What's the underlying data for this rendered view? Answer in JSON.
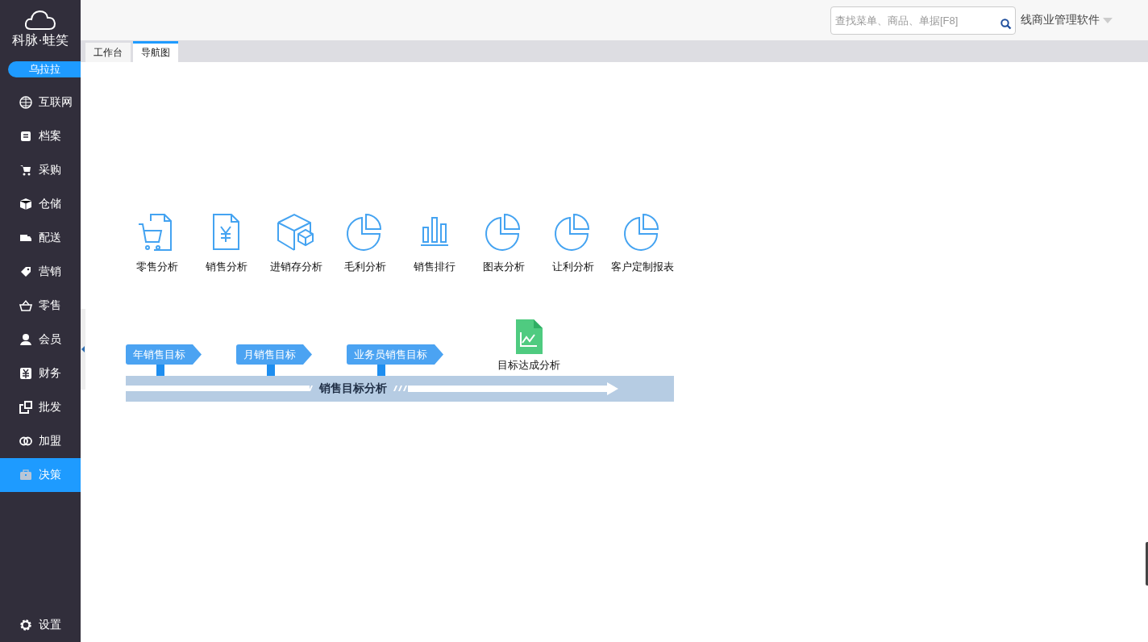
{
  "sidebar": {
    "logo_text": "科脉·蛙笑",
    "user": "乌拉拉",
    "items": [
      {
        "label": "互联网",
        "selected": false
      },
      {
        "label": "档案",
        "selected": false
      },
      {
        "label": "采购",
        "selected": false
      },
      {
        "label": "仓储",
        "selected": false
      },
      {
        "label": "配送",
        "selected": false
      },
      {
        "label": "营销",
        "selected": false
      },
      {
        "label": "零售",
        "selected": false
      },
      {
        "label": "会员",
        "selected": false
      },
      {
        "label": "财务",
        "selected": false
      },
      {
        "label": "批发",
        "selected": false
      },
      {
        "label": "加盟",
        "selected": false
      },
      {
        "label": "决策",
        "selected": true
      }
    ],
    "settings": "设置"
  },
  "header": {
    "search": {
      "placeholder": "查找菜单、商品、单据[F8]"
    },
    "product": "线商业管理软件"
  },
  "tabs": [
    {
      "label": "工作台",
      "selected": false
    },
    {
      "label": "导航图",
      "selected": true
    }
  ],
  "reports": [
    {
      "label": "零售分析",
      "kind": "cart"
    },
    {
      "label": "销售分析",
      "kind": "yen"
    },
    {
      "label": "进销存分析",
      "kind": "box"
    },
    {
      "label": "毛利分析",
      "kind": "pie"
    },
    {
      "label": "销售排行",
      "kind": "bars"
    },
    {
      "label": "图表分析",
      "kind": "pie"
    },
    {
      "label": "让利分析",
      "kind": "pie"
    },
    {
      "label": "客户定制报表",
      "kind": "pie"
    }
  ],
  "goals": {
    "flags": [
      "年销售目标",
      "月销售目标",
      "业务员销售目标"
    ],
    "band_title": "销售目标分析",
    "achievement": "目标达成分析"
  }
}
